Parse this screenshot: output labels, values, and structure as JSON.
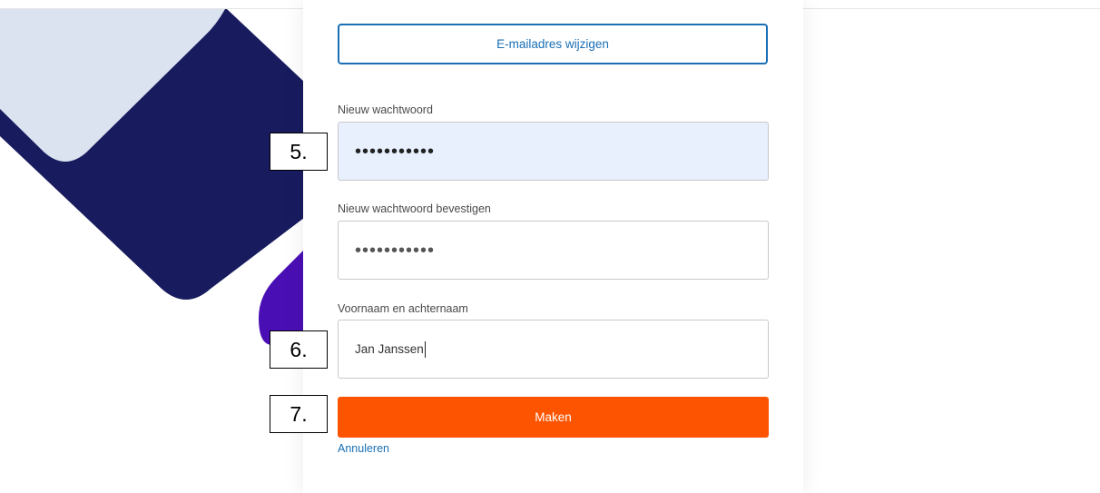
{
  "form": {
    "change_email_label": "E-mailadres wijzigen",
    "new_password": {
      "label": "Nieuw wachtwoord",
      "value": "•••••••••••"
    },
    "confirm_password": {
      "label": "Nieuw wachtwoord bevestigen",
      "value": "•••••••••••"
    },
    "full_name": {
      "label": "Voornaam en achternaam",
      "value": "Jan Janssen"
    },
    "submit_label": "Maken",
    "cancel_label": "Annuleren"
  },
  "annotations": {
    "step_5": "5.",
    "step_6": "6.",
    "step_7": "7."
  },
  "colors": {
    "accent_blue": "#1a6fb5",
    "primary_orange": "#fc5400",
    "autofill_bg": "#e8effd",
    "decor_navy": "#181b5e",
    "decor_light": "#dbe2f0",
    "decor_purple": "#4a0fb4"
  }
}
